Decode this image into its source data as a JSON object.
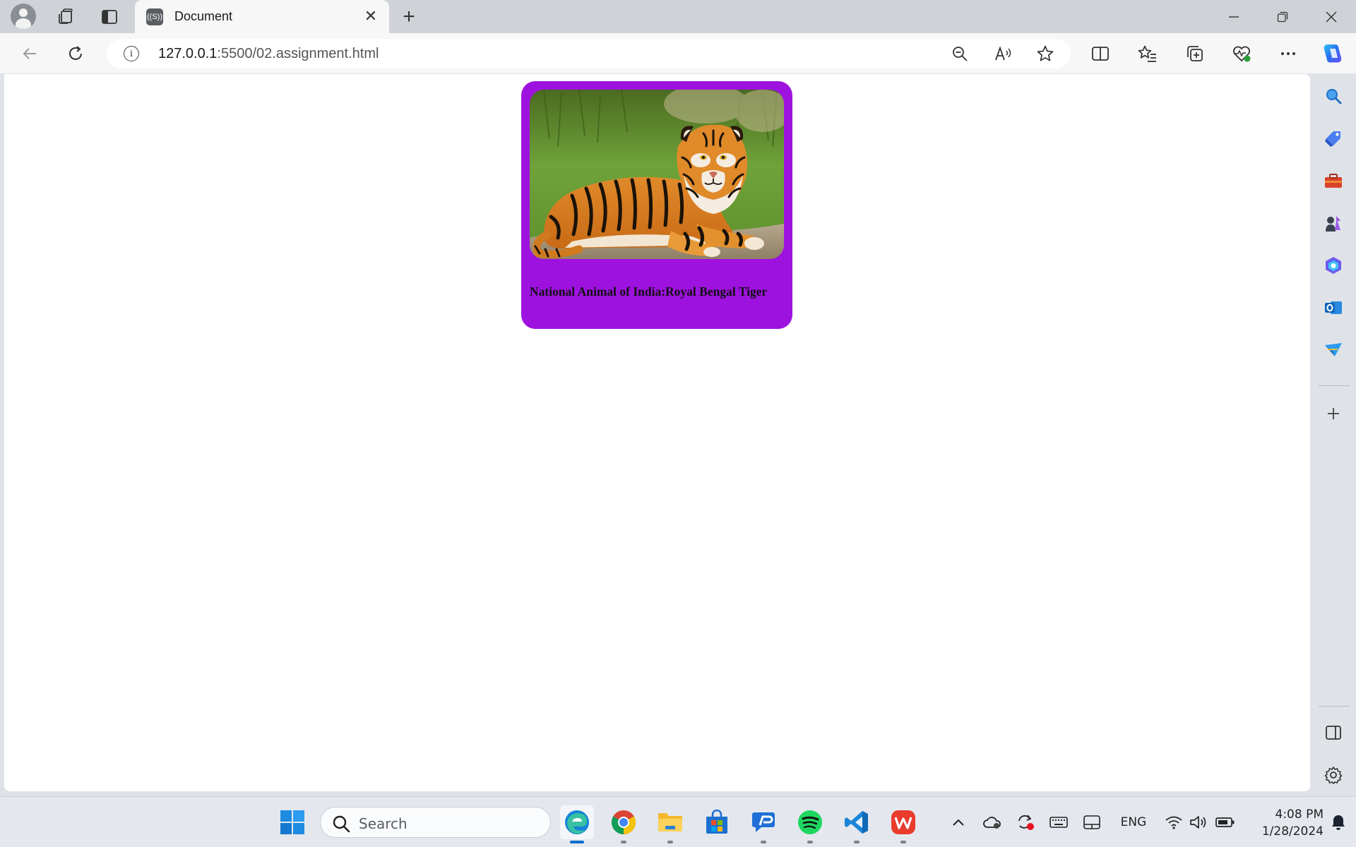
{
  "browser": {
    "tab_title": "Document",
    "tab_favicon": "((S))",
    "url_host": "127.0.0.1",
    "url_path": ":5500/02.assignment.html"
  },
  "page": {
    "caption": "National Animal of India:Royal Bengal Tiger",
    "card_color": "#9e12df"
  },
  "taskbar": {
    "search_label": "Search",
    "language": "ENG",
    "time": "4:08 PM",
    "date": "1/28/2024"
  },
  "icons": {
    "titlebar": [
      "profile-icon",
      "workspaces-icon",
      "vertical-tabs-icon",
      "close-tab-icon",
      "new-tab-icon",
      "minimize-icon",
      "restore-icon",
      "close-window-icon"
    ],
    "toolbar": [
      "back-icon",
      "refresh-icon",
      "site-info-icon",
      "zoom-out-icon",
      "read-aloud-icon",
      "favorite-star-icon",
      "split-screen-icon",
      "favorites-icon",
      "collections-icon",
      "browser-essentials-icon",
      "more-icon",
      "copilot-icon"
    ],
    "sidebar": [
      "search-icon",
      "shopping-tag-icon",
      "tools-icon",
      "games-icon",
      "microsoft-365-icon",
      "outlook-icon",
      "drop-icon",
      "add-icon",
      "hide-sidebar-icon",
      "settings-icon"
    ],
    "taskbar": [
      "windows-start-icon",
      "edge-icon",
      "chrome-icon",
      "file-explorer-icon",
      "microsoft-store-icon",
      "quick-assist-icon",
      "spotify-icon",
      "vscode-icon",
      "wps-office-icon"
    ]
  }
}
